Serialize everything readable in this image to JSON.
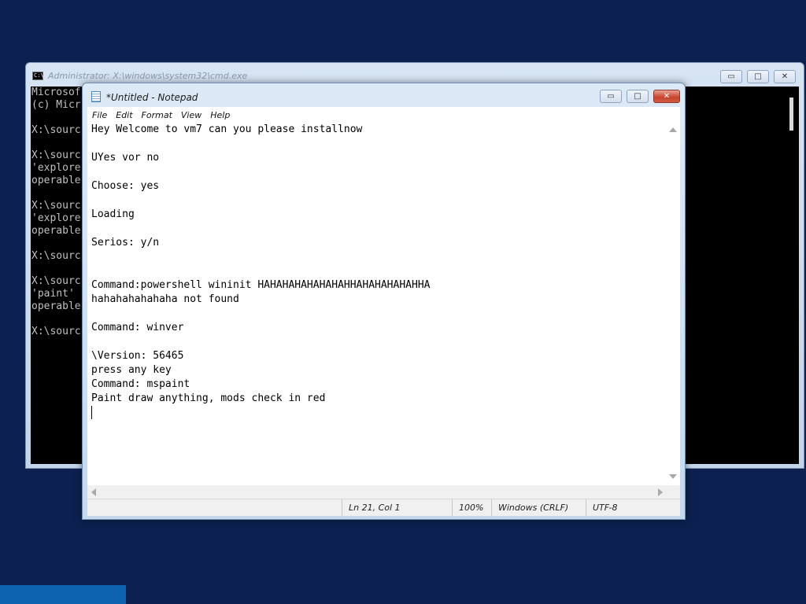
{
  "cmd": {
    "title": "Administrator: X:\\windows\\system32\\cmd.exe",
    "icon": "C:\\",
    "lines": [
      "Microsof",
      "(c) Micr",
      "",
      "X:\\sourc",
      "",
      "X:\\sourc",
      "'explore",
      "operable",
      "",
      "X:\\sourc",
      "'explore",
      "operable",
      "",
      "X:\\sourc",
      "",
      "X:\\sourc",
      "'paint'",
      "operable",
      "",
      "X:\\sourc"
    ],
    "buttons": {
      "minimize": "▭",
      "maximize": "□",
      "close": "✕"
    }
  },
  "notepad": {
    "title": "*Untitled - Notepad",
    "menu": [
      "File",
      "Edit",
      "Format",
      "View",
      "Help"
    ],
    "buttons": {
      "minimize": "▭",
      "maximize": "□",
      "close": "✕"
    },
    "text": "Hey Welcome to vm7 can you please installnow\n\nUYes vor no\n\nChoose: yes\n\nLoading\n\nSerios: y/n\n\n\nCommand:powershell wininit HAHAHAHAHAHAHAHHAHAHAHAHAHHA\nhahahahahahaha not found\n\nCommand: winver\n\n\\Version: 56465\npress any key\nCommand: mspaint\nPaint draw anything, mods check in red",
    "status": {
      "position": "Ln 21, Col 1",
      "zoom": "100%",
      "line_ending": "Windows (CRLF)",
      "encoding": "UTF-8"
    }
  },
  "colors": {
    "desktop": "#0c2150",
    "taskbar_accent": "#0d63b0",
    "cmd_background": "#000000",
    "cmd_text": "#c0c0c0",
    "close_button": "#c7432c"
  }
}
